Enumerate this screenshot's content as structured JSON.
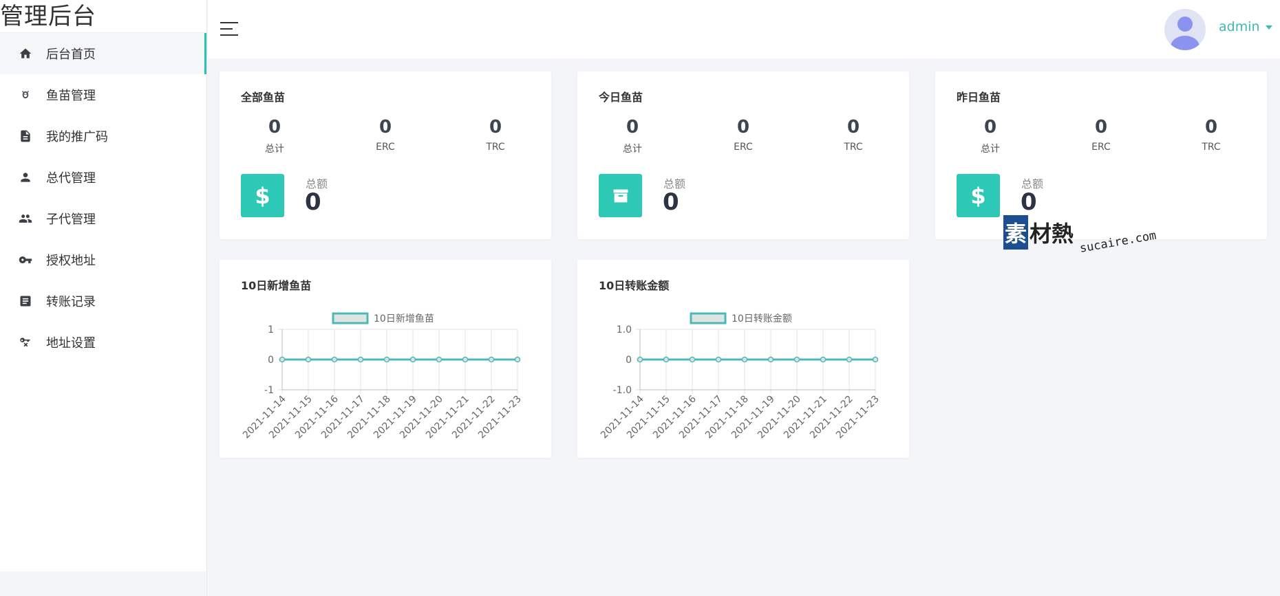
{
  "brand": "管理后台",
  "sidebar": {
    "items": [
      {
        "label": "后台首页",
        "icon": "home-icon"
      },
      {
        "label": "鱼苗管理",
        "icon": "fish-icon"
      },
      {
        "label": "我的推广码",
        "icon": "document-icon"
      },
      {
        "label": "总代管理",
        "icon": "person-icon"
      },
      {
        "label": "子代管理",
        "icon": "people-icon"
      },
      {
        "label": "授权地址",
        "icon": "key-icon"
      },
      {
        "label": "转账记录",
        "icon": "list-icon"
      },
      {
        "label": "地址设置",
        "icon": "key-x-icon"
      }
    ]
  },
  "header": {
    "user": "admin"
  },
  "stats": [
    {
      "title": "全部鱼苗",
      "cols": [
        {
          "value": "0",
          "label": "总计"
        },
        {
          "value": "0",
          "label": "ERC"
        },
        {
          "value": "0",
          "label": "TRC"
        }
      ],
      "icon": "dollar-icon",
      "icon_glyph": "$",
      "total_label": "总额",
      "total_value": "0"
    },
    {
      "title": "今日鱼苗",
      "cols": [
        {
          "value": "0",
          "label": "总计"
        },
        {
          "value": "0",
          "label": "ERC"
        },
        {
          "value": "0",
          "label": "TRC"
        }
      ],
      "icon": "archive-icon",
      "icon_glyph": "",
      "total_label": "总额",
      "total_value": "0"
    },
    {
      "title": "昨日鱼苗",
      "cols": [
        {
          "value": "0",
          "label": "总计"
        },
        {
          "value": "0",
          "label": "ERC"
        },
        {
          "value": "0",
          "label": "TRC"
        }
      ],
      "icon": "dollar-icon",
      "icon_glyph": "$",
      "total_label": "总额",
      "total_value": "0"
    }
  ],
  "charts": [
    {
      "title": "10日新增鱼苗"
    },
    {
      "title": "10日转账金额"
    }
  ],
  "chart_data": [
    {
      "type": "line",
      "title": "10日新增鱼苗",
      "categories": [
        "2021-11-14",
        "2021-11-15",
        "2021-11-16",
        "2021-11-17",
        "2021-11-18",
        "2021-11-19",
        "2021-11-20",
        "2021-11-21",
        "2021-11-22",
        "2021-11-23"
      ],
      "series": [
        {
          "name": "10日新增鱼苗",
          "values": [
            0,
            0,
            0,
            0,
            0,
            0,
            0,
            0,
            0,
            0
          ]
        }
      ],
      "yticks": [
        "1",
        "0",
        "-1"
      ],
      "ylim": [
        -1,
        1
      ],
      "legend": "top",
      "grid": true,
      "color": "#4fb8b6"
    },
    {
      "type": "line",
      "title": "10日转账金额",
      "categories": [
        "2021-11-14",
        "2021-11-15",
        "2021-11-16",
        "2021-11-17",
        "2021-11-18",
        "2021-11-19",
        "2021-11-20",
        "2021-11-21",
        "2021-11-22",
        "2021-11-23"
      ],
      "series": [
        {
          "name": "10日转账金额",
          "values": [
            0,
            0,
            0,
            0,
            0,
            0,
            0,
            0,
            0,
            0
          ]
        }
      ],
      "yticks": [
        "1.0",
        "0",
        "-1.0"
      ],
      "ylim": [
        -1,
        1
      ],
      "legend": "top",
      "grid": true,
      "color": "#4fb8b6"
    }
  ],
  "watermark": {
    "text_cn": "素材熱",
    "text_en": "sucaire.com"
  },
  "colors": {
    "accent": "#2ec8b7",
    "link": "#3fb9b4",
    "line": "#4fb8b6"
  }
}
